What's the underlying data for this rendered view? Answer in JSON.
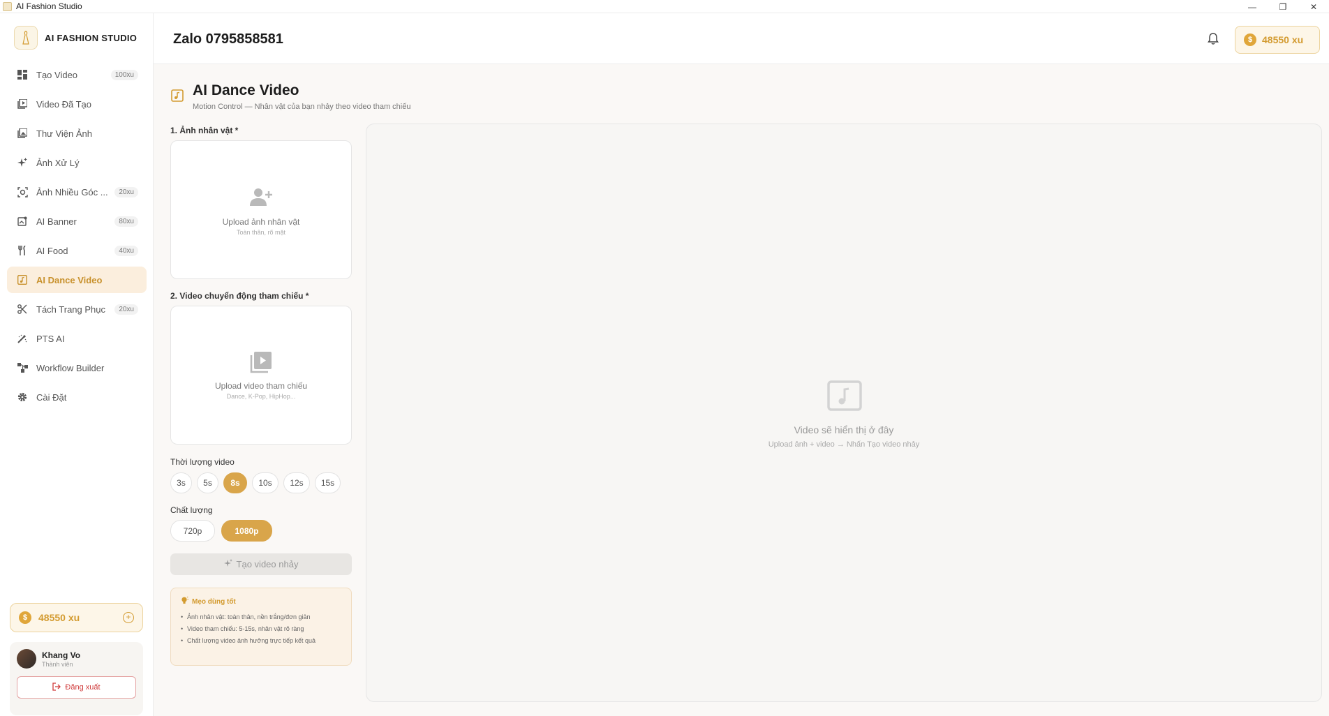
{
  "window": {
    "title": "AI Fashion Studio",
    "minimize": "—",
    "maximize": "❐",
    "close": "✕"
  },
  "sidebar": {
    "brand": "AI FASHION STUDIO",
    "items": [
      {
        "label": "Tạo Video",
        "badge": "100xu",
        "icon": "grid-icon"
      },
      {
        "label": "Video Đã Tạo",
        "badge": "",
        "icon": "video-library-icon"
      },
      {
        "label": "Thư Viện Ảnh",
        "badge": "",
        "icon": "photo-library-icon"
      },
      {
        "label": "Ảnh Xử Lý",
        "badge": "",
        "icon": "sparkle-icon"
      },
      {
        "label": "Ảnh Nhiều Góc ...",
        "badge": "20xu",
        "icon": "camera-focus-icon"
      },
      {
        "label": "AI Banner",
        "badge": "80xu",
        "icon": "banner-icon"
      },
      {
        "label": "AI Food",
        "badge": "40xu",
        "icon": "utensils-icon"
      },
      {
        "label": "AI Dance Video",
        "badge": "",
        "icon": "music-note-icon",
        "active": true
      },
      {
        "label": "Tách Trang Phục",
        "badge": "20xu",
        "icon": "scissors-icon"
      },
      {
        "label": "PTS AI",
        "badge": "",
        "icon": "magic-wand-icon"
      },
      {
        "label": "Workflow Builder",
        "badge": "",
        "icon": "workflow-icon"
      },
      {
        "label": "Cài Đặt",
        "badge": "",
        "icon": "gear-icon"
      }
    ],
    "coins": "48550 xu",
    "user": {
      "name": "Khang Vo",
      "role": "Thành viên"
    },
    "logout": "Đăng xuất"
  },
  "header": {
    "title": "Zalo 0795858581",
    "coins": "48550 xu"
  },
  "page": {
    "title": "AI Dance Video",
    "subtitle": "Motion Control — Nhân vật của bạn nhảy theo video tham chiếu",
    "character": {
      "label": "1. Ảnh nhân vật *",
      "upload_title": "Upload ảnh nhân vật",
      "upload_hint": "Toàn thân, rõ mặt"
    },
    "motion": {
      "label": "2. Video chuyển động tham chiếu *",
      "upload_title": "Upload video tham chiếu",
      "upload_hint": "Dance, K-Pop, HipHop..."
    },
    "duration": {
      "label": "Thời lượng video",
      "options": [
        "3s",
        "5s",
        "8s",
        "10s",
        "12s",
        "15s"
      ],
      "selected": "8s"
    },
    "quality": {
      "label": "Chất lượng",
      "options": [
        "720p",
        "1080p"
      ],
      "selected": "1080p"
    },
    "generate": "Tạo video nhảy",
    "tips": {
      "title": "Mẹo dùng tốt",
      "items": [
        "Ảnh nhân vật: toàn thân, nền trắng/đơn giản",
        "Video tham chiếu: 5-15s, nhân vật rõ ràng",
        "Chất lượng video ảnh hưởng trực tiếp kết quả"
      ]
    },
    "preview": {
      "title": "Video sẽ hiển thị ở đây",
      "hint": "Upload ảnh + video → Nhấn Tạo video nhảy"
    }
  },
  "colors": {
    "accent": "#d9a54a",
    "accent_text": "#d39b30",
    "active_bg": "#fbeedd",
    "danger": "#d03b3b"
  }
}
